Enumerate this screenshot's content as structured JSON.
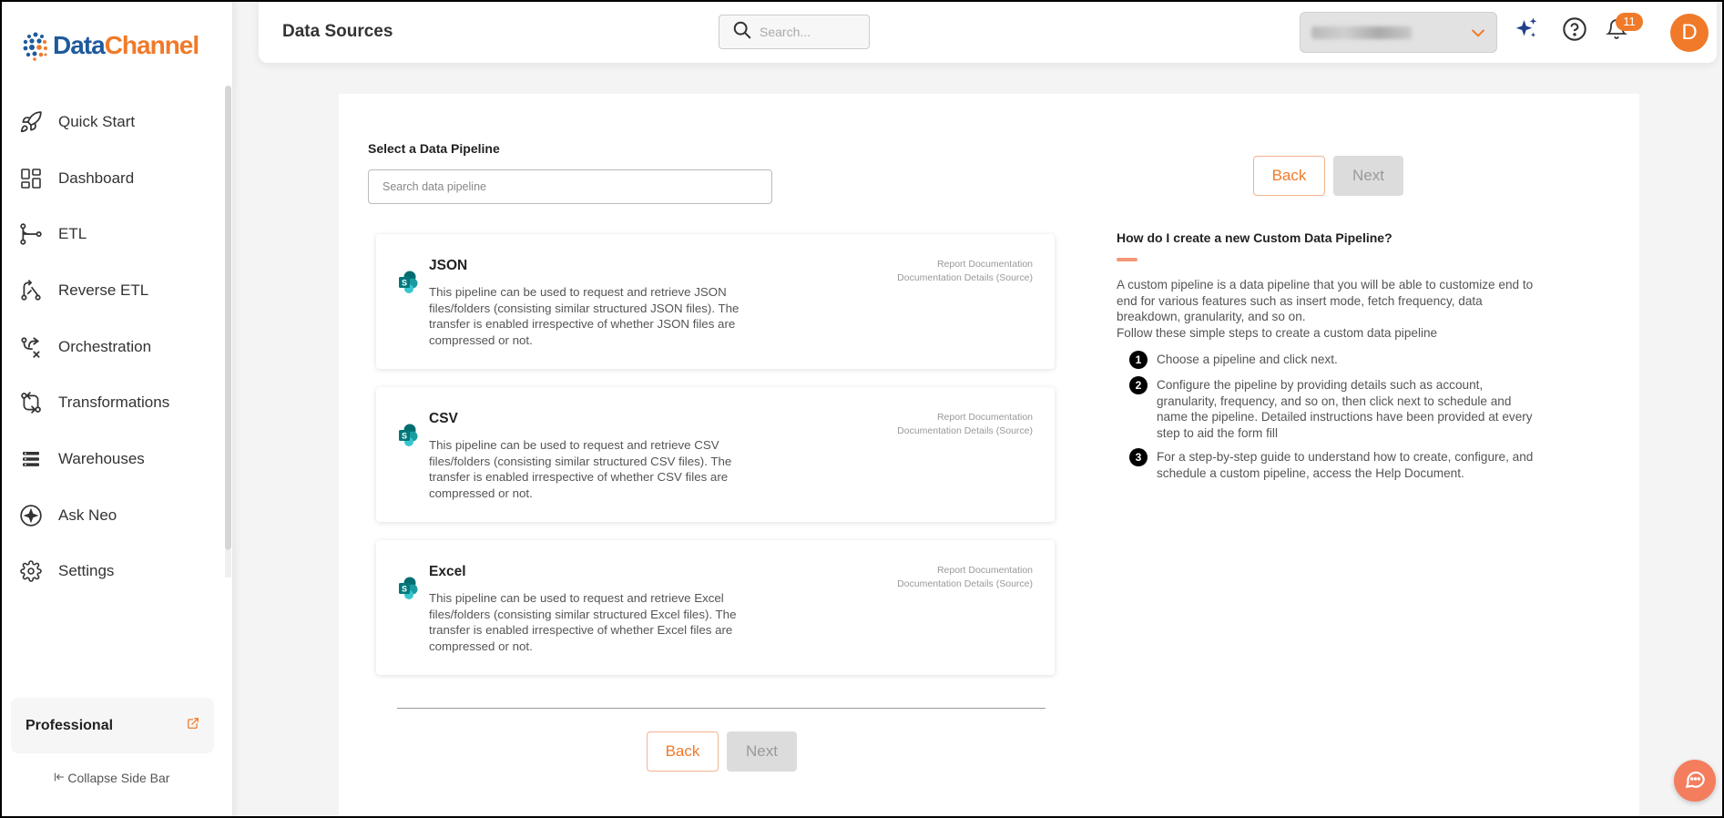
{
  "brand": {
    "name_part1": "Data",
    "name_part2": "Channel",
    "accent": "#f07a2a",
    "primary": "#1f5a9c"
  },
  "sidebar": {
    "items": [
      {
        "label": "Quick Start",
        "icon": "rocket-icon"
      },
      {
        "label": "Dashboard",
        "icon": "dashboard-icon"
      },
      {
        "label": "ETL",
        "icon": "etl-icon"
      },
      {
        "label": "Reverse ETL",
        "icon": "reverse-etl-icon"
      },
      {
        "label": "Orchestration",
        "icon": "orchestration-icon"
      },
      {
        "label": "Transformations",
        "icon": "transformations-icon"
      },
      {
        "label": "Warehouses",
        "icon": "warehouses-icon"
      },
      {
        "label": "Ask Neo",
        "icon": "sparkle-icon"
      },
      {
        "label": "Settings",
        "icon": "gear-icon"
      }
    ],
    "plan": "Professional",
    "collapse_label": "Collapse Side Bar"
  },
  "header": {
    "title": "Data Sources",
    "search_placeholder": "Search...",
    "notification_count": "11",
    "avatar_initial": "D"
  },
  "main": {
    "section_label": "Select a Data Pipeline",
    "search_placeholder": "Search data pipeline",
    "back_label": "Back",
    "next_label": "Next",
    "pipelines": [
      {
        "title": "JSON",
        "description": "This pipeline can be used to request and retrieve JSON files/folders (consisting similar structured JSON files). The transfer is enabled irrespective of whether JSON files are compressed or not.",
        "link1": "Report Documentation",
        "link2": "Documentation Details (Source)"
      },
      {
        "title": "CSV",
        "description": "This pipeline can be used to request and retrieve CSV files/folders (consisting similar structured CSV files). The transfer is enabled irrespective of whether CSV files are compressed or not.",
        "link1": "Report Documentation",
        "link2": "Documentation Details (Source)"
      },
      {
        "title": "Excel",
        "description": "This pipeline can be used to request and retrieve Excel files/folders (consisting similar structured Excel files). The transfer is enabled irrespective of whether Excel files are compressed or not.",
        "link1": "Report Documentation",
        "link2": "Documentation Details (Source)"
      }
    ]
  },
  "help": {
    "title": "How do I create a new Custom Data Pipeline?",
    "intro": "A custom pipeline is a data pipeline that you will be able to customize end to end for various features such as insert mode, fetch frequency, data breakdown, granularity, and so on.",
    "intro2": "Follow these simple steps to create a custom data pipeline",
    "steps": [
      {
        "num": "1",
        "text": "Choose a pipeline and click next."
      },
      {
        "num": "2",
        "text": "Configure the pipeline by providing details such as account, granularity, frequency, and so on, then click next to schedule and name the pipeline. Detailed instructions have been provided at every step to aid the form fill"
      },
      {
        "num": "3",
        "text": "For a step-by-step guide to understand how to create, configure, and schedule a custom pipeline, access the Help Document."
      }
    ]
  }
}
